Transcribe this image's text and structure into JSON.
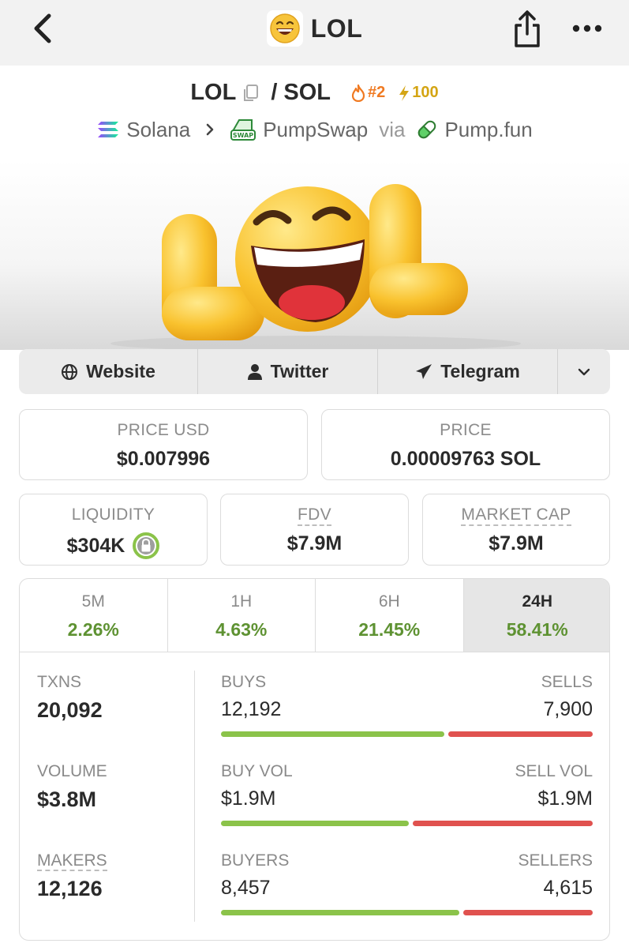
{
  "header": {
    "title": "LOL",
    "emoji": "😄",
    "icons": [
      "back-chevron-icon",
      "share-icon",
      "more-icon"
    ]
  },
  "pair": {
    "base": "LOL",
    "separator": "/",
    "quote": "SOL",
    "rank": "#2",
    "boost": "100"
  },
  "chain": {
    "chain_name": "Solana",
    "dex_name": "PumpSwap",
    "via_label": "via",
    "launchpad": "Pump.fun"
  },
  "links": {
    "website": "Website",
    "twitter": "Twitter",
    "telegram": "Telegram"
  },
  "stats": {
    "price_usd_label": "PRICE USD",
    "price_usd": "$0.007996",
    "price_label": "PRICE",
    "price_native": "0.00009763 SOL",
    "liquidity_label": "LIQUIDITY",
    "liquidity": "$304K",
    "fdv_label": "FDV",
    "fdv": "$7.9M",
    "mcap_label": "MARKET CAP",
    "mcap": "$7.9M"
  },
  "timeframes": [
    {
      "label": "5M",
      "value": "2.26%"
    },
    {
      "label": "1H",
      "value": "4.63%"
    },
    {
      "label": "6H",
      "value": "21.45%"
    },
    {
      "label": "24H",
      "value": "58.41%"
    }
  ],
  "activity": {
    "txns_label": "TXNS",
    "txns": "20,092",
    "volume_label": "VOLUME",
    "volume": "$3.8M",
    "makers_label": "MAKERS",
    "makers": "12,126",
    "buys_label": "BUYS",
    "buys": "12,192",
    "sells_label": "SELLS",
    "sells": "7,900",
    "buy_vol_label": "BUY VOL",
    "buy_vol": "$1.9M",
    "sell_vol_label": "SELL VOL",
    "sell_vol": "$1.9M",
    "buyers_label": "BUYERS",
    "buyers": "8,457",
    "sellers_label": "SELLERS",
    "sellers": "4,615",
    "buy_share_txns": 0.607,
    "buy_share_vol": 0.51,
    "buy_share_makers": 0.647
  },
  "colors": {
    "positive": "#5e9232",
    "buy_bar": "#8bc34a",
    "sell_bar": "#e0524f",
    "rank": "#f07a22",
    "boost": "#d4a514"
  }
}
